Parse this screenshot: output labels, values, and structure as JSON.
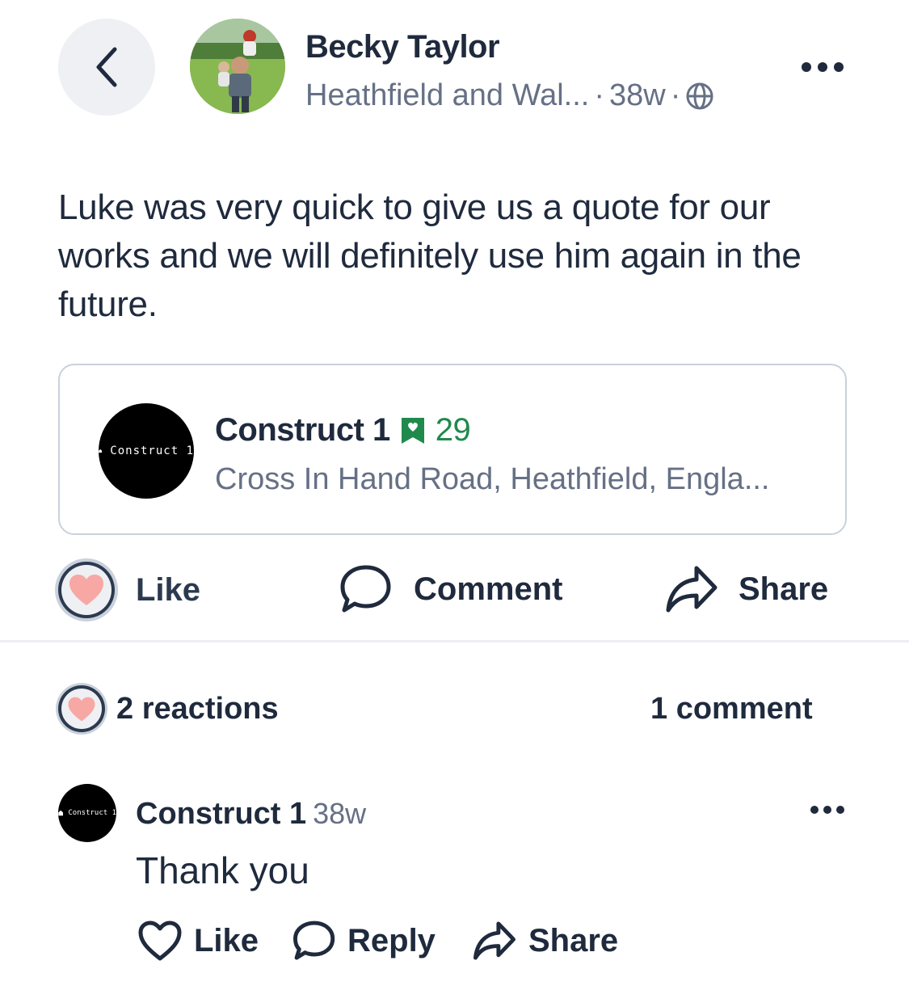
{
  "post": {
    "author": "Becky Taylor",
    "location": "Heathfield and Wal...",
    "age": "38w",
    "separator": "·",
    "body": "Luke was very quick to give us a quote for our works and we will definitely use him again in the future."
  },
  "business": {
    "name": "Construct 1",
    "recommendations": "29",
    "address": "Cross In Hand Road, Heathfield,  Engla...",
    "logo_text": "Construct 1"
  },
  "actions": {
    "like": "Like",
    "comment": "Comment",
    "share": "Share"
  },
  "stats": {
    "reactions": "2 reactions",
    "comments": "1 comment"
  },
  "comment": {
    "author": "Construct 1",
    "age": "38w",
    "text": "Thank you",
    "logo_text": "Construct 1",
    "like": "Like",
    "reply": "Reply",
    "share": "Share"
  },
  "colors": {
    "heart": "#f7a8a4",
    "recommend_green": "#1f8a4c",
    "text_dark": "#1f2a3d",
    "text_muted": "#667085"
  }
}
